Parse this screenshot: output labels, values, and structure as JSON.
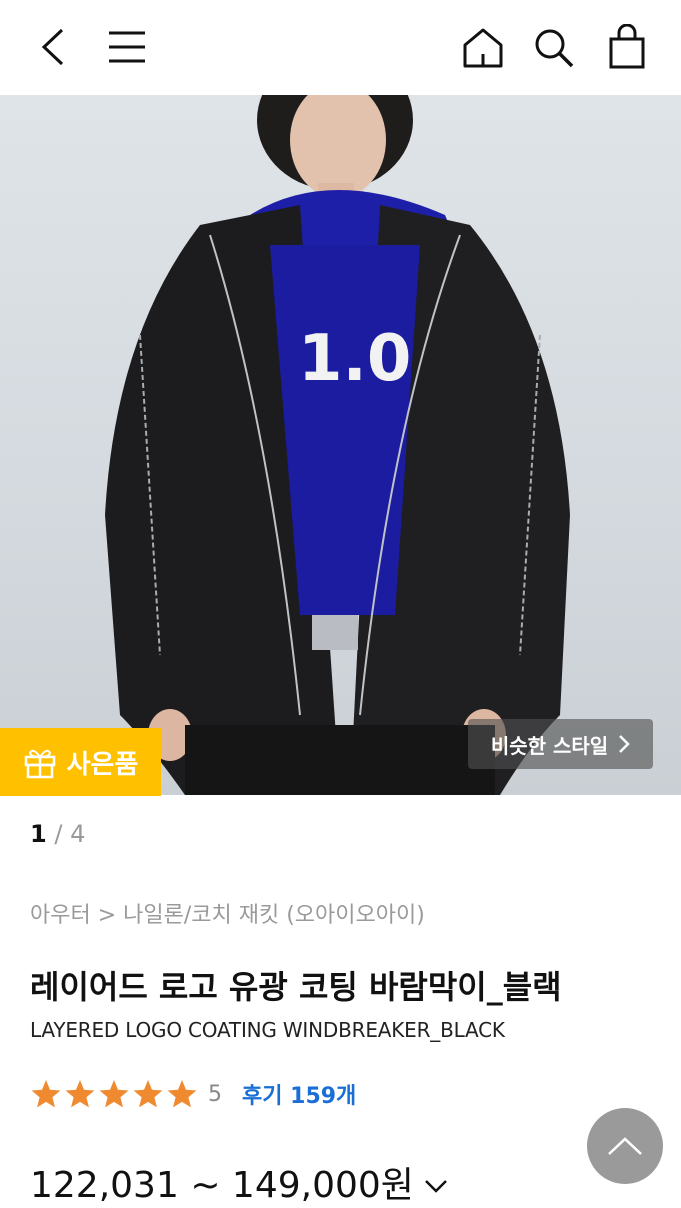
{
  "header": {
    "icons": [
      "back-icon",
      "menu-icon",
      "home-icon",
      "search-icon",
      "cart-icon"
    ]
  },
  "hero": {
    "gift_label": "사은품",
    "similar_style_label": "비슷한 스타일",
    "accent_color": "#ffc000",
    "image_description_icon": "product-photo"
  },
  "pager": {
    "current": "1",
    "separator": "/",
    "total": "4"
  },
  "product": {
    "breadcrumb": "아우터 > 나일론/코치 재킷 (오아이오아이)",
    "title_ko": "레이어드 로고 유광 코팅 바람막이_블랙",
    "title_en": "LAYERED LOGO COATING WINDBREAKER_BLACK",
    "rating_value": "5",
    "rating_stars": 5,
    "star_color": "#f08a30",
    "review_label": "후기 159개",
    "review_color": "#1a6fd6",
    "price_range": "122,031 ~ 149,000원"
  }
}
